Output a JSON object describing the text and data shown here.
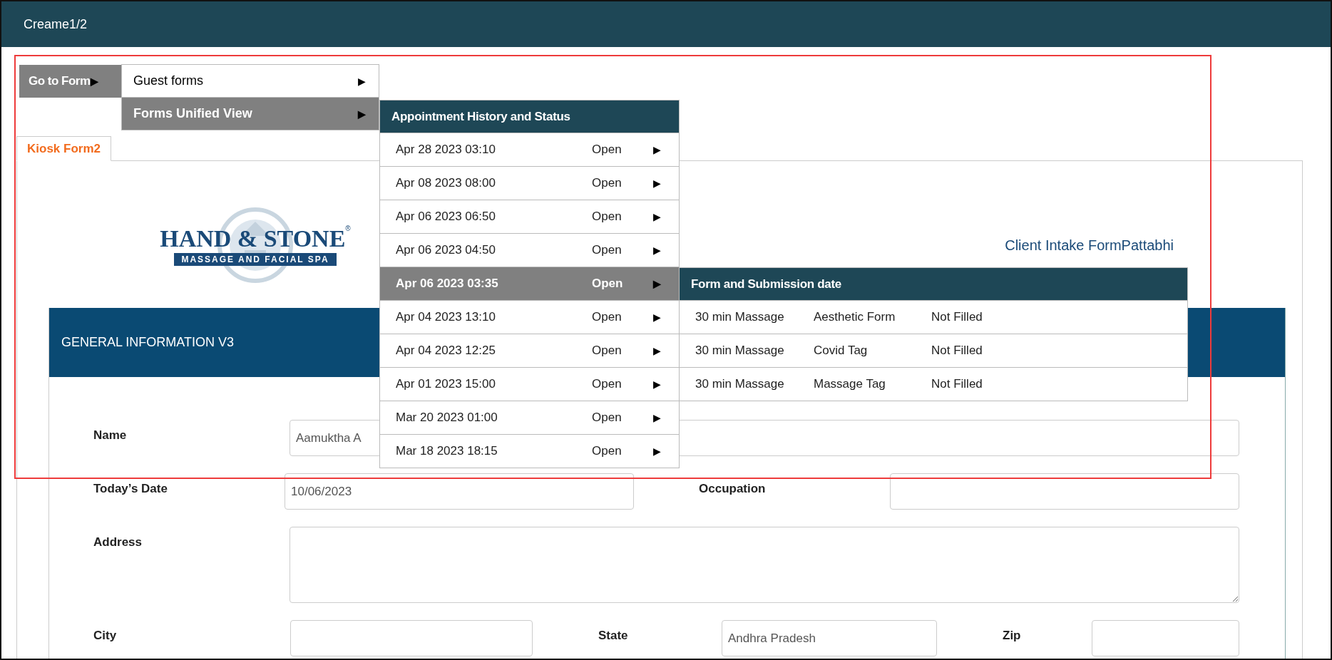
{
  "window": {
    "title": "Creame1/2"
  },
  "menu": {
    "button": "Go to Form",
    "button_arrow": "▶",
    "items": [
      {
        "label": "Guest forms",
        "arrow": "▶",
        "selected": false
      },
      {
        "label": "Forms Unified View",
        "arrow": "▶",
        "selected": true
      }
    ]
  },
  "appointments": {
    "title": "Appointment History and Status",
    "rows": [
      {
        "date": "Apr 28 2023 03:10",
        "status": "Open",
        "arrow": "▶",
        "selected": false
      },
      {
        "date": "Apr 08 2023 08:00",
        "status": "Open",
        "arrow": "▶",
        "selected": false
      },
      {
        "date": "Apr 06 2023 06:50",
        "status": "Open",
        "arrow": "▶",
        "selected": false
      },
      {
        "date": "Apr 06 2023 04:50",
        "status": "Open",
        "arrow": "▶",
        "selected": false
      },
      {
        "date": "Apr 06 2023 03:35",
        "status": "Open",
        "arrow": "▶",
        "selected": true
      },
      {
        "date": "Apr 04 2023 13:10",
        "status": "Open",
        "arrow": "▶",
        "selected": false
      },
      {
        "date": "Apr 04 2023 12:25",
        "status": "Open",
        "arrow": "▶",
        "selected": false
      },
      {
        "date": "Apr 01 2023 15:00",
        "status": "Open",
        "arrow": "▶",
        "selected": false
      },
      {
        "date": "Mar 20 2023 01:00",
        "status": "Open",
        "arrow": "▶",
        "selected": false
      },
      {
        "date": "Mar 18 2023 18:15",
        "status": "Open",
        "arrow": "▶",
        "selected": false
      }
    ]
  },
  "submissions": {
    "title": "Form and Submission date",
    "rows": [
      {
        "service": "30 min Massage",
        "form": "Aesthetic Form",
        "status": "Not Filled"
      },
      {
        "service": "30 min Massage",
        "form": "Covid Tag",
        "status": "Not Filled"
      },
      {
        "service": "30 min Massage",
        "form": "Massage Tag",
        "status": "Not Filled"
      }
    ]
  },
  "tabs": [
    {
      "label": "Kiosk Form2",
      "selected": true
    }
  ],
  "logo": {
    "name": "HAND & STONE",
    "mark": "®",
    "tagline": "MASSAGE AND FACIAL SPA"
  },
  "form_title": "Client Intake FormPattabhi",
  "section": {
    "title": "GENERAL INFORMATION V3"
  },
  "fields": [
    {
      "label": "Name",
      "value": "Aamuktha A"
    },
    {
      "label": "Today’s Date",
      "value": "10/06/2023"
    },
    {
      "label": "Occupation"
    },
    {
      "label": "Address",
      "kind": "textarea"
    },
    {
      "label": "City"
    },
    {
      "label": "State",
      "value": "Andhra Pradesh"
    },
    {
      "label": "Zip"
    }
  ]
}
